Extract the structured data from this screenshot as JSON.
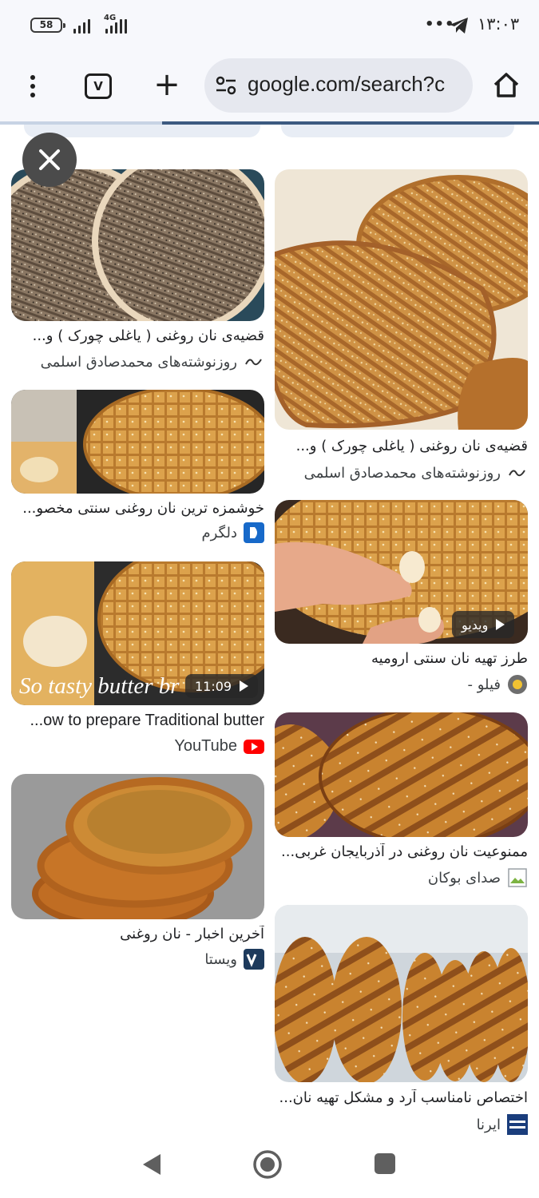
{
  "status_bar": {
    "battery_level": "58",
    "network_type": "4G",
    "notification_dots": "•••",
    "time": "۱۳:۰۳",
    "icons": [
      "battery-icon",
      "signal-icon",
      "telegram-icon"
    ]
  },
  "browser": {
    "tab_count": "V",
    "url": "google.com/search?c",
    "icons": [
      "more-vert-icon",
      "tabs-icon",
      "new-tab-icon",
      "site-settings-icon",
      "home-icon"
    ],
    "load_progress": 0.3
  },
  "close_button": {
    "icon": "close-icon"
  },
  "results": [
    {
      "caption": "قضیه‌ی نان روغنی ( یاغلی چورک ) و...",
      "source": "روزنوشته‌های محمدصادق اسلمی",
      "favicon": "blog-signature-icon"
    },
    {
      "caption": "قضیه‌ی نان روغنی ( یاغلی چورک ) و...",
      "source": "روزنوشته‌های محمدصادق اسلمی",
      "favicon": "blog-signature-icon"
    },
    {
      "caption": "خوشمزه ترین نان روغنی سنتی مخصو...",
      "source": "دلگرم",
      "favicon": "delgarm-icon"
    },
    {
      "caption": "طرز تهیه نان سنتی ارومیه",
      "source": "- فیلو",
      "favicon": "filo-icon",
      "badge": "ویدیو"
    },
    {
      "caption": "...ow to prepare Traditional butter",
      "source": "YouTube",
      "favicon": "youtube-icon",
      "duration": "11:09",
      "overlay_text": "So tasty butter br"
    },
    {
      "caption": "ممنوعیت نان روغنی در آذربایجان غربی...",
      "source": "صدای بوکان",
      "favicon": "broken-image-icon"
    },
    {
      "caption": "آخرین اخبار - نان روغنی",
      "source": "ویستا",
      "favicon": "vista-icon"
    },
    {
      "caption": "اختصاص نامناسب آرد و مشکل تهیه نان...",
      "source": "ایرنا",
      "favicon": "irna-icon"
    }
  ],
  "nav_bar": {
    "icons": [
      "back-icon",
      "home-circle-icon",
      "recent-apps-icon"
    ]
  },
  "colors": {
    "omnibox": "#e6e8ef",
    "progress": "#3c5a80",
    "youtube": "#ff0000",
    "bread": "#d59a46"
  }
}
